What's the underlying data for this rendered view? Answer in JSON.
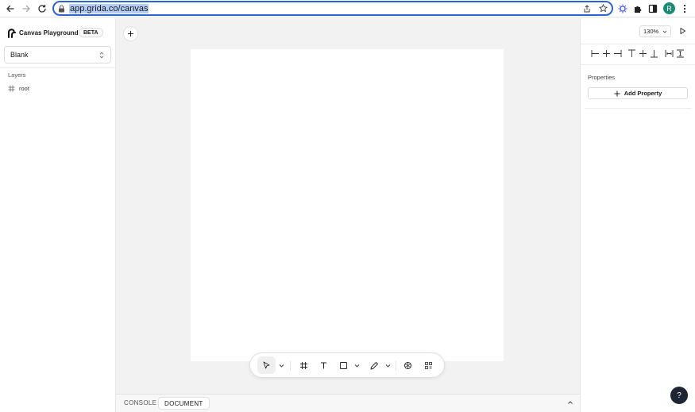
{
  "browser": {
    "url": "app.grida.co/canvas",
    "avatar_initial": "R",
    "avatar_color": "#1b8a74",
    "accent": "#2b63d9"
  },
  "sidebar": {
    "app_title": "Canvas Playground",
    "badge": "BETA",
    "document_select_value": "Blank",
    "layers_label": "Layers",
    "layers": [
      {
        "label": "root",
        "icon": "hash-frame-icon"
      }
    ]
  },
  "canvas": {
    "background": "#f2f2f2",
    "toolbar": [
      "cursor-icon",
      "chevron-down-icon",
      "frame-hash-icon",
      "text-icon",
      "rectangle-icon",
      "chevron-down-icon",
      "pencil-icon",
      "chevron-down-icon",
      "openai-icon",
      "scan-icon"
    ]
  },
  "bottom_panel": {
    "tabs": [
      "CONSOLE",
      "DOCUMENT"
    ],
    "active_tab": "DOCUMENT"
  },
  "right_panel": {
    "zoom": "130%",
    "properties_label": "Properties",
    "add_property_label": "Add Property",
    "help_label": "?"
  }
}
